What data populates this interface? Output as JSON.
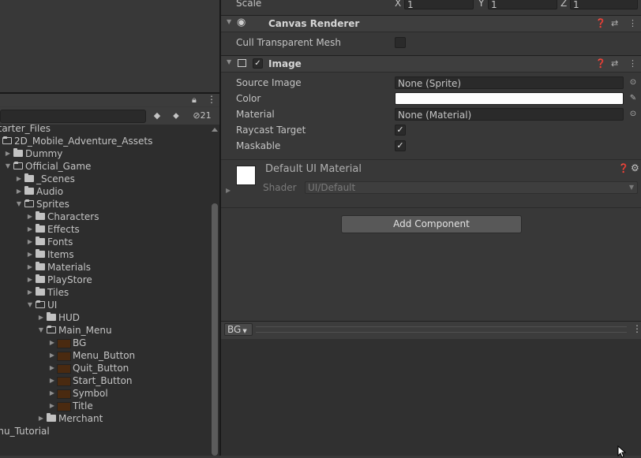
{
  "inspector": {
    "scale": {
      "label": "Scale",
      "x_label": "X",
      "x": "1",
      "y_label": "Y",
      "y": "1",
      "z_label": "Z",
      "z": "1"
    },
    "canvas_renderer": {
      "title": "Canvas Renderer",
      "cull_label": "Cull Transparent Mesh",
      "cull_checked": false
    },
    "image": {
      "title": "Image",
      "enabled": true,
      "source_image_label": "Source Image",
      "source_image_value": "None (Sprite)",
      "color_label": "Color",
      "color_value": "#ffffff",
      "material_label": "Material",
      "material_value": "None (Material)",
      "raycast_label": "Raycast Target",
      "raycast_checked": true,
      "maskable_label": "Maskable",
      "maskable_checked": true
    },
    "material_preview": {
      "name": "Default UI Material",
      "shader_label": "Shader",
      "shader_value": "UI/Default"
    },
    "add_component_label": "Add Component",
    "preview_label": "BG"
  },
  "project": {
    "hidden_count": "21",
    "tree": [
      {
        "label": "Starter_Files",
        "depth": 0,
        "type": "text"
      },
      {
        "label": "2D_Mobile_Adventure_Assets",
        "depth": 0,
        "type": "folder-open"
      },
      {
        "label": "Dummy",
        "depth": 1,
        "type": "folder"
      },
      {
        "label": "Official_Game",
        "depth": 1,
        "type": "folder-open"
      },
      {
        "label": "_Scenes",
        "depth": 2,
        "type": "folder"
      },
      {
        "label": "Audio",
        "depth": 2,
        "type": "folder"
      },
      {
        "label": "Sprites",
        "depth": 2,
        "type": "folder-open"
      },
      {
        "label": "Characters",
        "depth": 3,
        "type": "folder"
      },
      {
        "label": "Effects",
        "depth": 3,
        "type": "folder"
      },
      {
        "label": "Fonts",
        "depth": 3,
        "type": "folder"
      },
      {
        "label": "Items",
        "depth": 3,
        "type": "folder"
      },
      {
        "label": "Materials",
        "depth": 3,
        "type": "folder"
      },
      {
        "label": "PlayStore",
        "depth": 3,
        "type": "folder"
      },
      {
        "label": "Tiles",
        "depth": 3,
        "type": "folder"
      },
      {
        "label": "UI",
        "depth": 3,
        "type": "folder-open"
      },
      {
        "label": "HUD",
        "depth": 4,
        "type": "folder"
      },
      {
        "label": "Main_Menu",
        "depth": 4,
        "type": "folder-open"
      },
      {
        "label": "BG",
        "depth": 5,
        "type": "sprite"
      },
      {
        "label": "Menu_Button",
        "depth": 5,
        "type": "sprite"
      },
      {
        "label": "Quit_Button",
        "depth": 5,
        "type": "sprite"
      },
      {
        "label": "Start_Button",
        "depth": 5,
        "type": "sprite"
      },
      {
        "label": "Symbol",
        "depth": 5,
        "type": "sprite"
      },
      {
        "label": "Title",
        "depth": 5,
        "type": "sprite"
      },
      {
        "label": "Merchant",
        "depth": 4,
        "type": "folder"
      },
      {
        "label": "enu_Tutorial",
        "depth": 0,
        "type": "text"
      }
    ]
  }
}
